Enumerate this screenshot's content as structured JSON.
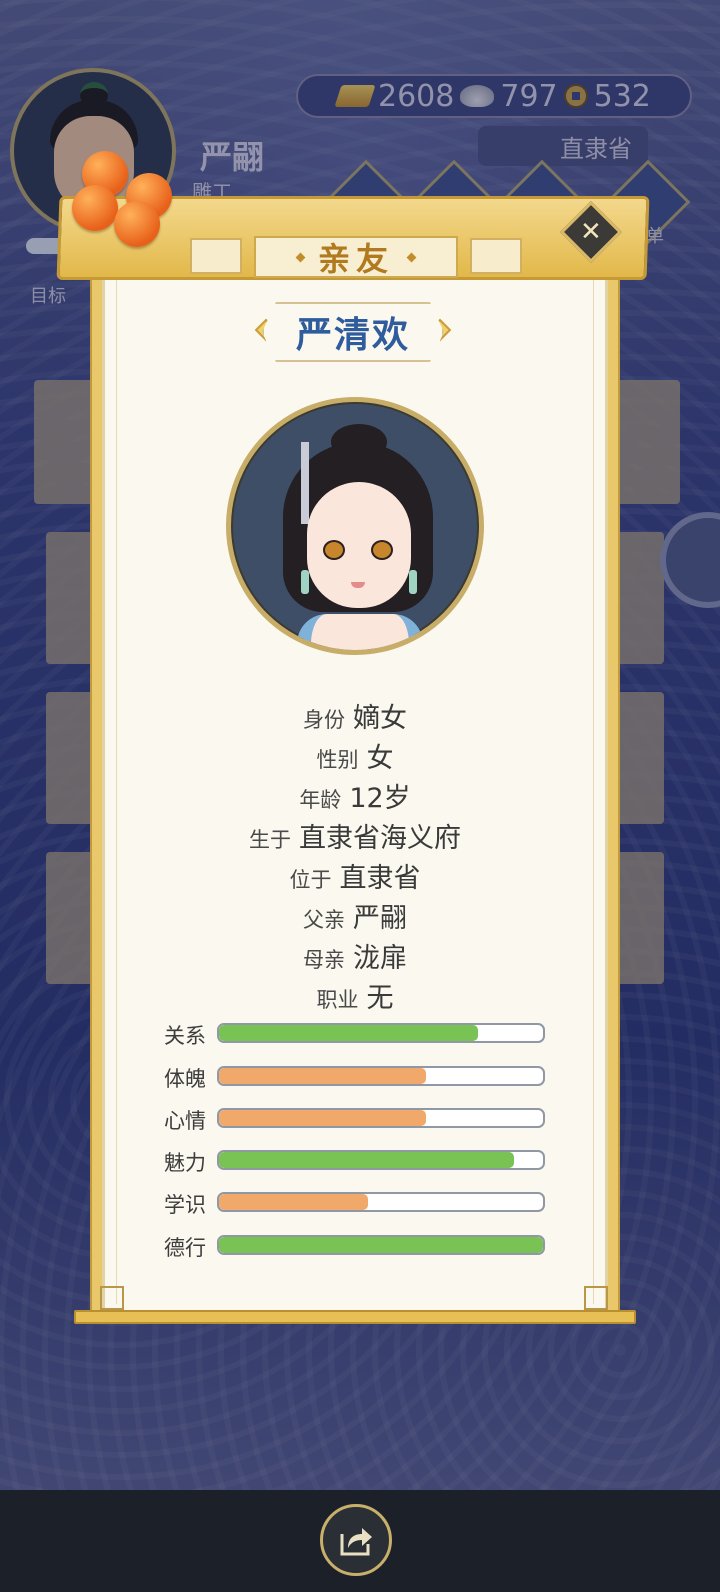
{
  "player": {
    "name": "严翤",
    "job": "雕工",
    "target_label": "目标",
    "progress": 0.6
  },
  "currency": {
    "gold": "2608",
    "silver": "797",
    "coins": "532"
  },
  "location": {
    "province": "直隶省"
  },
  "nav": {
    "menu_label": "菜单"
  },
  "dialog": {
    "tab_title": "亲友",
    "person_name": "严清欢",
    "info": [
      {
        "key": "身份",
        "value": "嫡女"
      },
      {
        "key": "性别",
        "value": "女"
      },
      {
        "key": "年龄",
        "value": "12岁"
      },
      {
        "key": "生于",
        "value": "直隶省海义府"
      },
      {
        "key": "位于",
        "value": "直隶省"
      },
      {
        "key": "父亲",
        "value": "严翤"
      },
      {
        "key": "母亲",
        "value": "泷扉"
      },
      {
        "key": "职业",
        "value": "无"
      }
    ],
    "stats": [
      {
        "label": "关系",
        "value": 0.8,
        "color": "#78c353"
      },
      {
        "label": "体魄",
        "value": 0.64,
        "color": "#f0a96a"
      },
      {
        "label": "心情",
        "value": 0.64,
        "color": "#f0a96a"
      },
      {
        "label": "魅力",
        "value": 0.91,
        "color": "#78c353"
      },
      {
        "label": "学识",
        "value": 0.46,
        "color": "#f0a96a"
      },
      {
        "label": "德行",
        "value": 1.0,
        "color": "#78c353"
      }
    ]
  },
  "icons": {
    "close": "close-icon",
    "share": "share-icon"
  }
}
